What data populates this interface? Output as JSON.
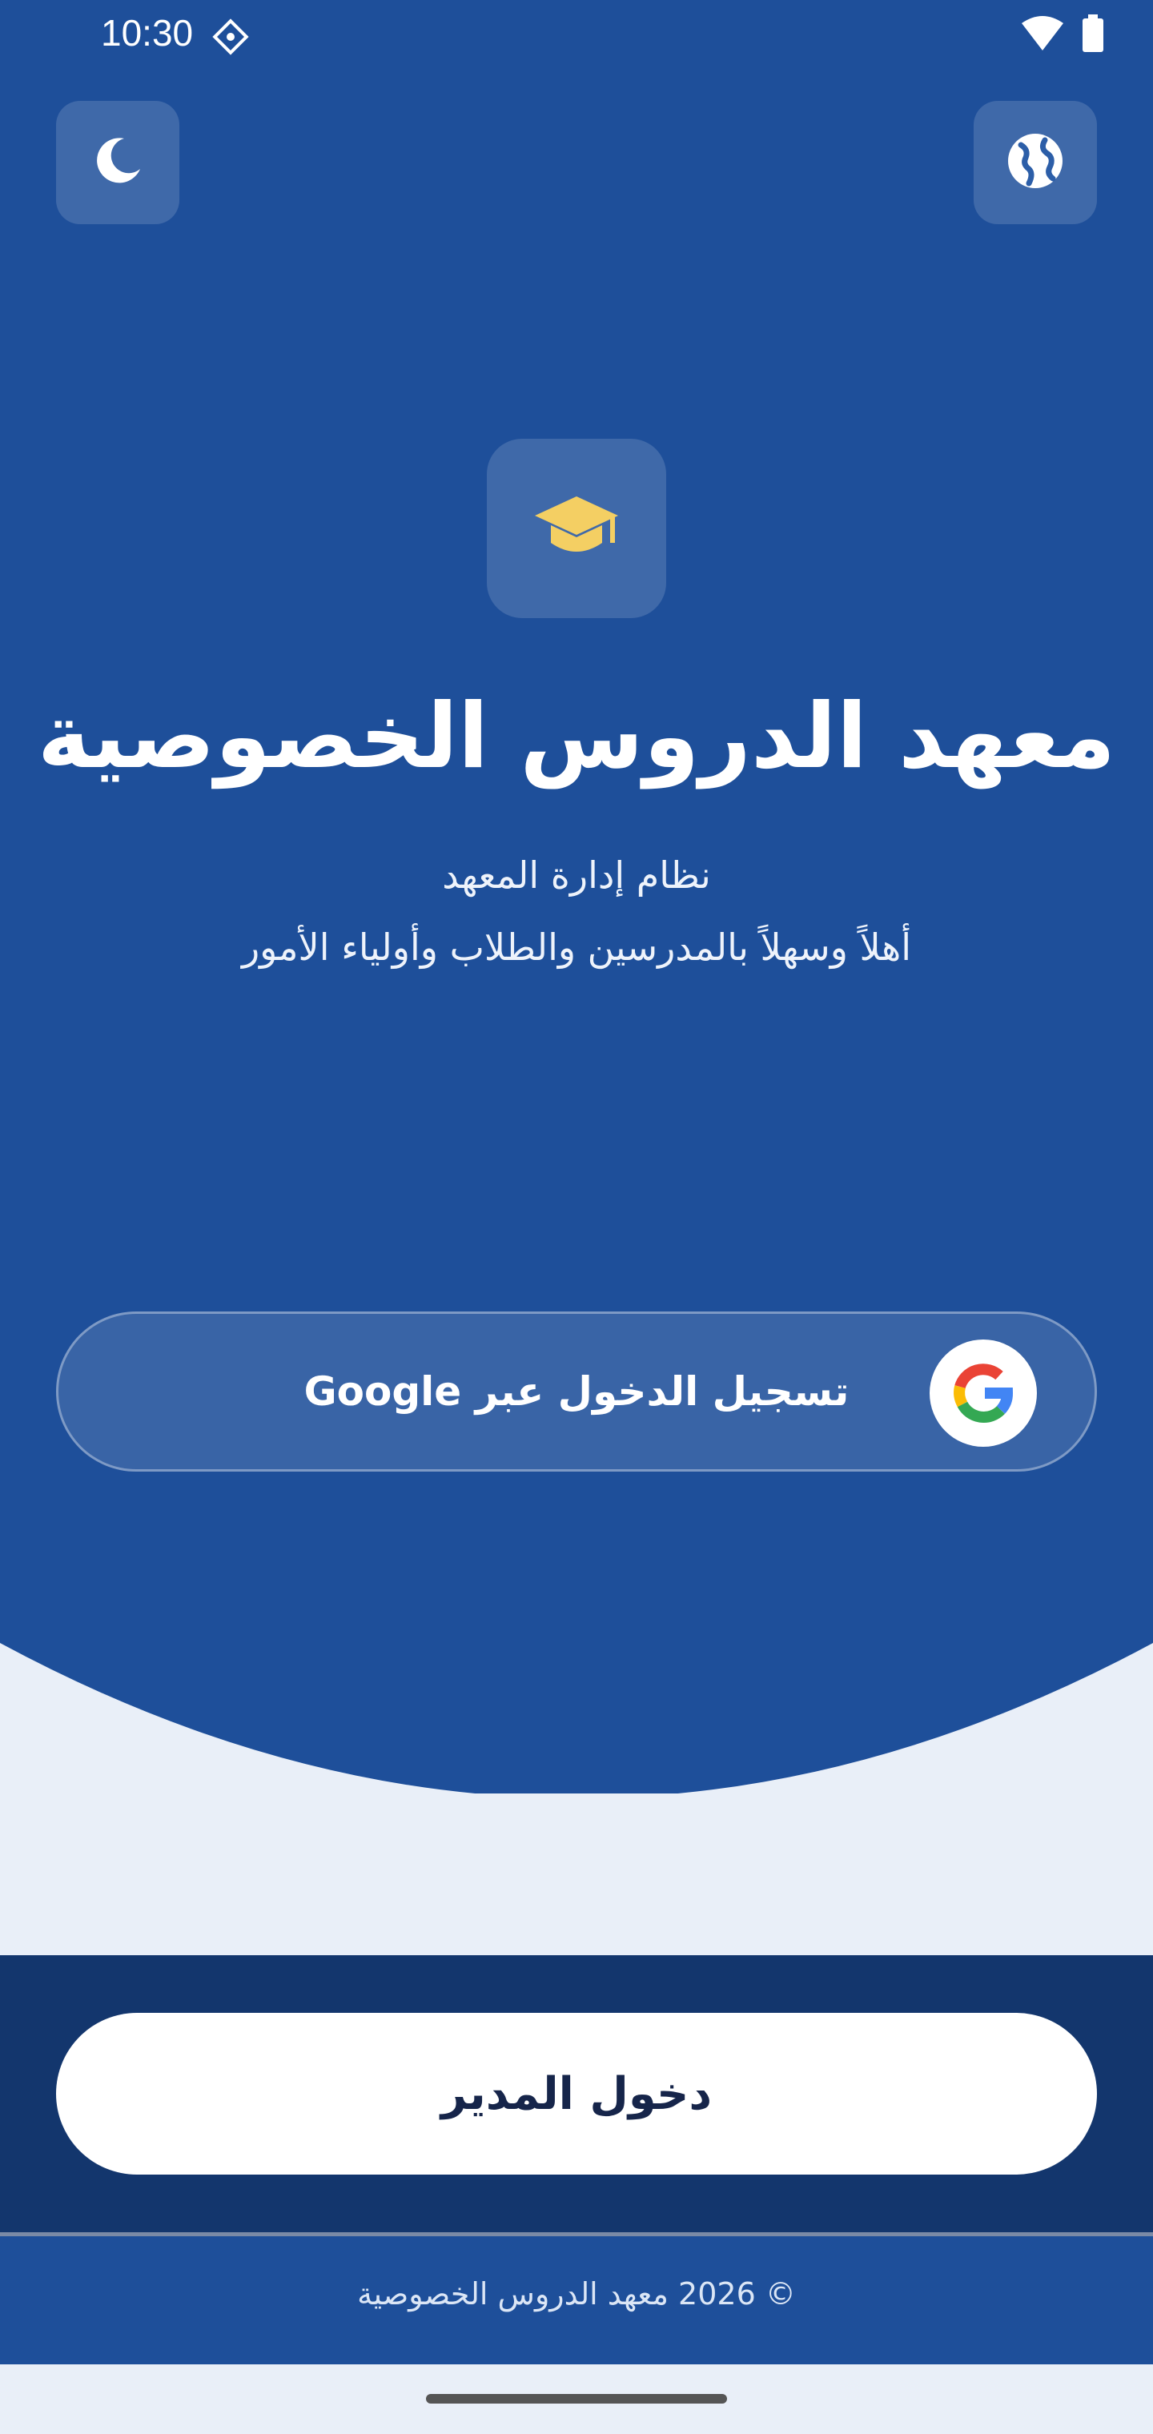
{
  "status_bar": {
    "time": "10:30",
    "icons": [
      "notification-diamond-icon",
      "wifi-icon",
      "battery-icon"
    ]
  },
  "top_actions": {
    "left_icon": "moon-icon",
    "right_icon": "globe-icon"
  },
  "branding": {
    "logo_icon": "graduation-cap-icon",
    "title": "معهد الدروس الخصوصية",
    "subtitle": "نظام إدارة المعهد",
    "welcome": "أهلاً وسهلاً بالمدرسين والطلاب وأولياء الأمور"
  },
  "google_signin": {
    "label": "تسجيل الدخول عبر Google",
    "icon": "google-icon"
  },
  "admin": {
    "label": "دخول المدير"
  },
  "footer": {
    "text": "© 2026 معهد الدروس الخصوصية"
  },
  "colors": {
    "primary": "#1e4f9a",
    "dark_panel": "#13366d",
    "light_background": "#e9eff8",
    "accent_yellow": "#f4cf63"
  }
}
